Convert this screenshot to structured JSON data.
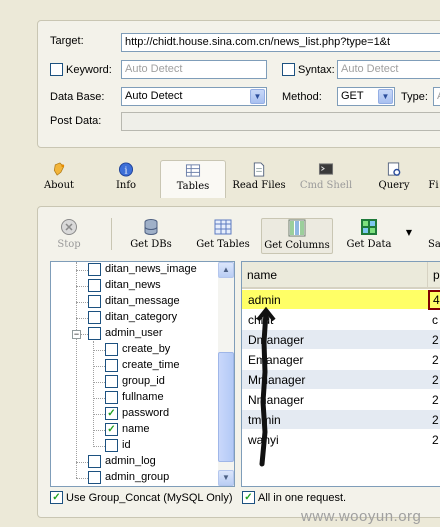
{
  "form": {
    "target_label": "Target:",
    "target_value": "http://chidt.house.sina.com.cn/news_list.php?type=1&t",
    "keyword_label": "Keyword:",
    "keyword_placeholder": "Auto Detect",
    "syntax_label": "Syntax:",
    "syntax_placeholder": "Auto Detect",
    "database_label": "Data Base:",
    "database_value": "Auto Detect",
    "method_label": "Method:",
    "method_value": "GET",
    "type_label": "Type:",
    "type_value": "A",
    "postdata_label": "Post Data:"
  },
  "tabs": [
    {
      "label": "About",
      "icon": "bell-icon"
    },
    {
      "label": "Info",
      "icon": "info-icon"
    },
    {
      "label": "Tables",
      "icon": "tables-icon"
    },
    {
      "label": "Read Files",
      "icon": "file-icon"
    },
    {
      "label": "Cmd Shell",
      "icon": "console-icon"
    },
    {
      "label": "Query",
      "icon": "query-icon"
    },
    {
      "label": "Fi",
      "icon": ""
    }
  ],
  "toolbar": {
    "stop": "Stop",
    "get_dbs": "Get DBs",
    "get_tables": "Get Tables",
    "get_columns": "Get Columns",
    "get_data": "Get Data",
    "more": "Sa"
  },
  "tree": {
    "items": [
      {
        "label": "ditan_news_image",
        "checked": false
      },
      {
        "label": "ditan_news",
        "checked": false
      },
      {
        "label": "ditan_message",
        "checked": false
      },
      {
        "label": "ditan_category",
        "checked": false
      },
      {
        "label": "admin_user",
        "checked": false,
        "expanded": true
      },
      {
        "label": "create_by",
        "checked": false
      },
      {
        "label": "create_time",
        "checked": false
      },
      {
        "label": "group_id",
        "checked": false
      },
      {
        "label": "fullname",
        "checked": false
      },
      {
        "label": "password",
        "checked": true
      },
      {
        "label": "name",
        "checked": true
      },
      {
        "label": "id",
        "checked": false
      },
      {
        "label": "admin_log",
        "checked": false
      },
      {
        "label": "admin_group",
        "checked": false
      }
    ]
  },
  "grid": {
    "columns": [
      "name",
      "p"
    ],
    "rows": [
      [
        "admin",
        "4"
      ],
      [
        "chidt",
        "c"
      ],
      [
        "Dmanager",
        "2"
      ],
      [
        "Emanager",
        "2"
      ],
      [
        "Mmanager",
        "2"
      ],
      [
        "Nmanager",
        "2"
      ],
      [
        "tmmin",
        "2"
      ],
      [
        "wanyi",
        "2"
      ]
    ]
  },
  "options": {
    "group_concat_label": "Use Group_Concat (MySQL Only)",
    "all_in_one_label": "All in one request."
  },
  "watermark": "www.wooyun.org",
  "colors": {
    "selected_row": "#ffff66",
    "alt_row": "#e4eaf2",
    "border": "#7f9db9"
  }
}
